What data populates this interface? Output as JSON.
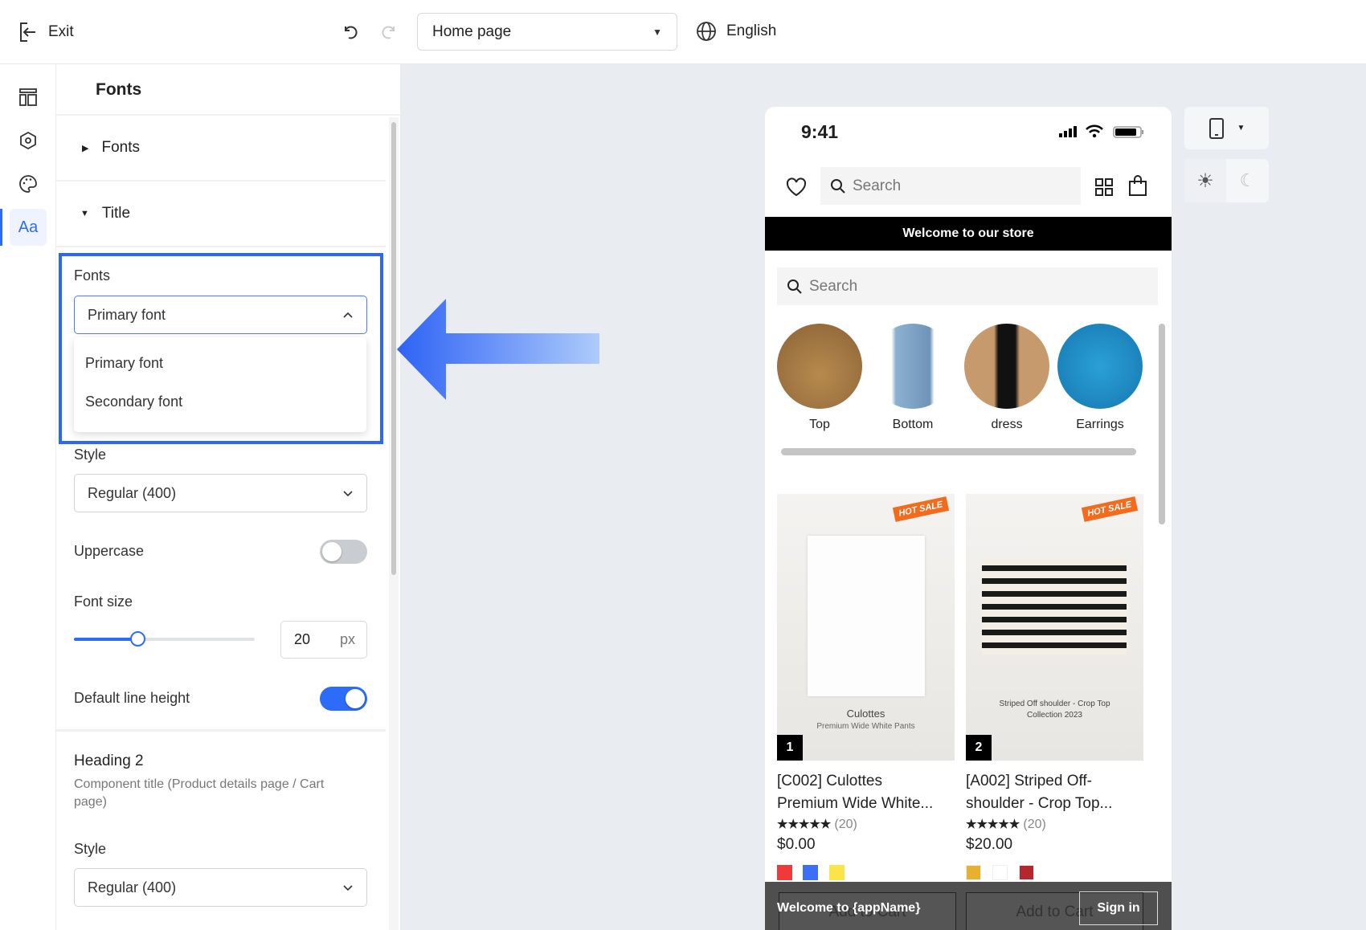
{
  "topbar": {
    "exit_label": "Exit",
    "page_select": "Home page",
    "language": "English"
  },
  "panel": {
    "title": "Fonts",
    "sections": [
      {
        "label": "Fonts",
        "expanded": false
      },
      {
        "label": "Title",
        "expanded": true
      }
    ],
    "title_section": {
      "fonts_label": "Fonts",
      "fonts_value": "Primary font",
      "fonts_options": [
        "Primary font",
        "Secondary font"
      ],
      "style_label": "Style",
      "style_value": "Regular (400)",
      "uppercase_label": "Uppercase",
      "uppercase_on": false,
      "font_size_label": "Font size",
      "font_size_value": "20",
      "font_size_unit": "px",
      "font_size_fraction": 0.35,
      "line_height_label": "Default line height",
      "line_height_on": true
    },
    "heading2": {
      "title": "Heading 2",
      "description": "Component title (Product details page / Cart page)",
      "style_label": "Style",
      "style_value": "Regular (400)"
    }
  },
  "phone": {
    "time": "9:41",
    "search_placeholder": "Search",
    "banner": "Welcome to our store",
    "search2_placeholder": "Search",
    "categories": [
      "Top",
      "Bottom",
      "dress",
      "Earrings"
    ],
    "products": [
      {
        "rank": "1",
        "title_line1": "[C002] Culottes",
        "title_line2": "Premium Wide White...",
        "rating": "★★★★★",
        "reviews": "(20)",
        "price": "$0.00",
        "image_caption": "Culottes",
        "image_sub": "Premium Wide White Pants",
        "tag": "HOT SALE",
        "swatches": [
          "#f03a3a",
          "#3b6ff5",
          "#fbe44a"
        ]
      },
      {
        "rank": "2",
        "title_line1": "[A002] Striped Off-",
        "title_line2": "shoulder - Crop Top...",
        "rating": "★★★★★",
        "reviews": "(20)",
        "price": "$20.00",
        "image_caption": "Striped Off shoulder - Crop Top",
        "image_sub": "Collection 2023",
        "tag": "HOT SALE",
        "swatches": [
          "#e6b22e",
          "#ffffff",
          "#b3282d"
        ]
      }
    ],
    "bottom_bar": {
      "welcome": "Welcome to {appName}",
      "add_to_cart": "Add to Cart",
      "sign_in": "Sign in"
    }
  },
  "colors": {
    "accent": "#2d6cf6",
    "highlight": "#2e67f5"
  }
}
